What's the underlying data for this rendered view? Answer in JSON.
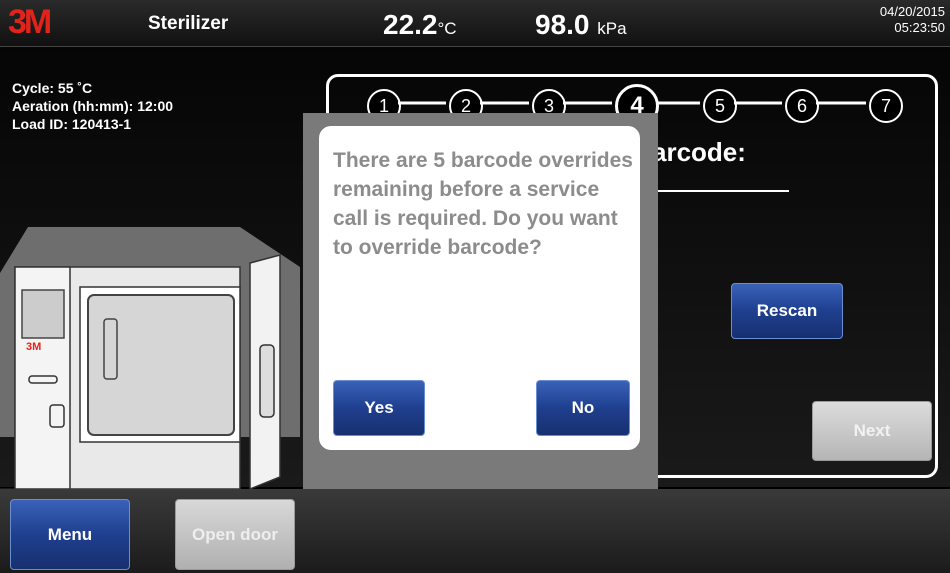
{
  "header": {
    "logo": "3M",
    "title": "Sterilizer",
    "temperature": "22.2",
    "temperature_unit": "°C",
    "pressure": "98.0",
    "pressure_unit": "kPa",
    "date": "04/20/2015",
    "time": "05:23:50"
  },
  "info": {
    "cycle": "Cycle: 55 ˚C",
    "aeration": "Aeration (hh:mm): 12:00",
    "load_id": "Load ID: 120413-1"
  },
  "sterilizer_label": "3M",
  "steps": [
    "1",
    "2",
    "3",
    "4",
    "5",
    "6",
    "7"
  ],
  "active_step": "4",
  "panel": {
    "title_fragment": "arcode:",
    "rescan_label": "Rescan",
    "next_label": "Next"
  },
  "modal": {
    "message": "There are 5 barcode overrides remaining before a service call is required.  Do you want to override barcode?",
    "yes_label": "Yes",
    "no_label": "No"
  },
  "footer": {
    "menu_label": "Menu",
    "open_door_label": "Open door"
  },
  "colors": {
    "brand": "#e2231a",
    "button_blue": "#1f3f8f",
    "disabled_gray": "#b5b5b5"
  }
}
